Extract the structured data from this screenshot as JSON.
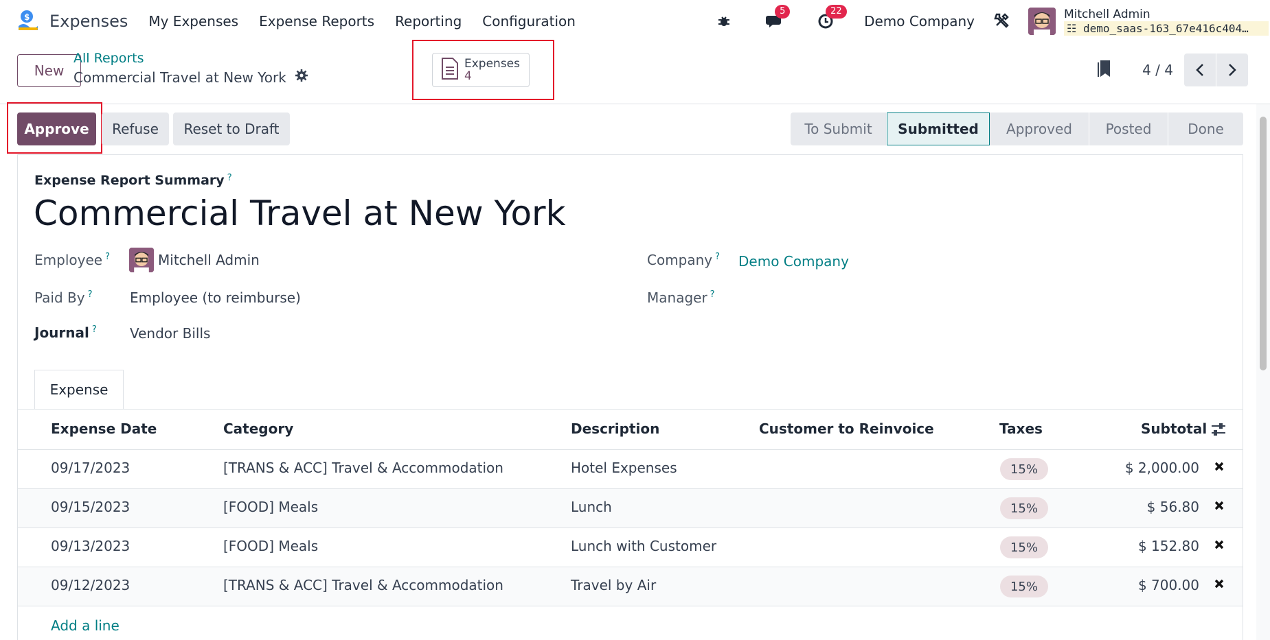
{
  "app": {
    "name": "Expenses",
    "menu": [
      "My Expenses",
      "Expense Reports",
      "Reporting",
      "Configuration"
    ],
    "messages_badge": "5",
    "activities_badge": "22",
    "company": "Demo Company",
    "user_name": "Mitchell Admin",
    "database": "demo_saas-163_67e416c404…"
  },
  "control": {
    "new_label": "New",
    "breadcrumb_parent": "All Reports",
    "breadcrumb_current": "Commercial Travel at New York",
    "smart_button_label": "Expenses",
    "smart_button_count": "4",
    "pager": "4 / 4"
  },
  "actions": {
    "approve": "Approve",
    "refuse": "Refuse",
    "reset": "Reset to Draft"
  },
  "stages": [
    "To Submit",
    "Submitted",
    "Approved",
    "Posted",
    "Done"
  ],
  "active_stage": "Submitted",
  "form": {
    "summary_label": "Expense Report Summary",
    "help_mark": "?",
    "title": "Commercial Travel at New York",
    "employee_label": "Employee",
    "employee_value": "Mitchell Admin",
    "paid_by_label": "Paid By",
    "paid_by_value": "Employee (to reimburse)",
    "journal_label": "Journal",
    "journal_value": "Vendor Bills",
    "company_label": "Company",
    "company_value": "Demo Company",
    "manager_label": "Manager"
  },
  "tab": "Expense",
  "table": {
    "headers": [
      "Expense Date",
      "Category",
      "Description",
      "Customer to Reinvoice",
      "Taxes",
      "Subtotal"
    ],
    "rows": [
      {
        "date": "09/17/2023",
        "category": "[TRANS & ACC] Travel & Accommodation",
        "description": "Hotel Expenses",
        "customer": "",
        "tax": "15%",
        "subtotal": "$ 2,000.00"
      },
      {
        "date": "09/15/2023",
        "category": "[FOOD] Meals",
        "description": "Lunch",
        "customer": "",
        "tax": "15%",
        "subtotal": "$ 56.80"
      },
      {
        "date": "09/13/2023",
        "category": "[FOOD] Meals",
        "description": "Lunch with Customer",
        "customer": "",
        "tax": "15%",
        "subtotal": "$ 152.80"
      },
      {
        "date": "09/12/2023",
        "category": "[TRANS & ACC] Travel & Accommodation",
        "description": "Travel by Air",
        "customer": "",
        "tax": "15%",
        "subtotal": "$ 700.00"
      }
    ],
    "add_line": "Add a line"
  },
  "colors": {
    "primary": "#714b67",
    "link": "#017e84",
    "highlight": "#e3172a"
  }
}
